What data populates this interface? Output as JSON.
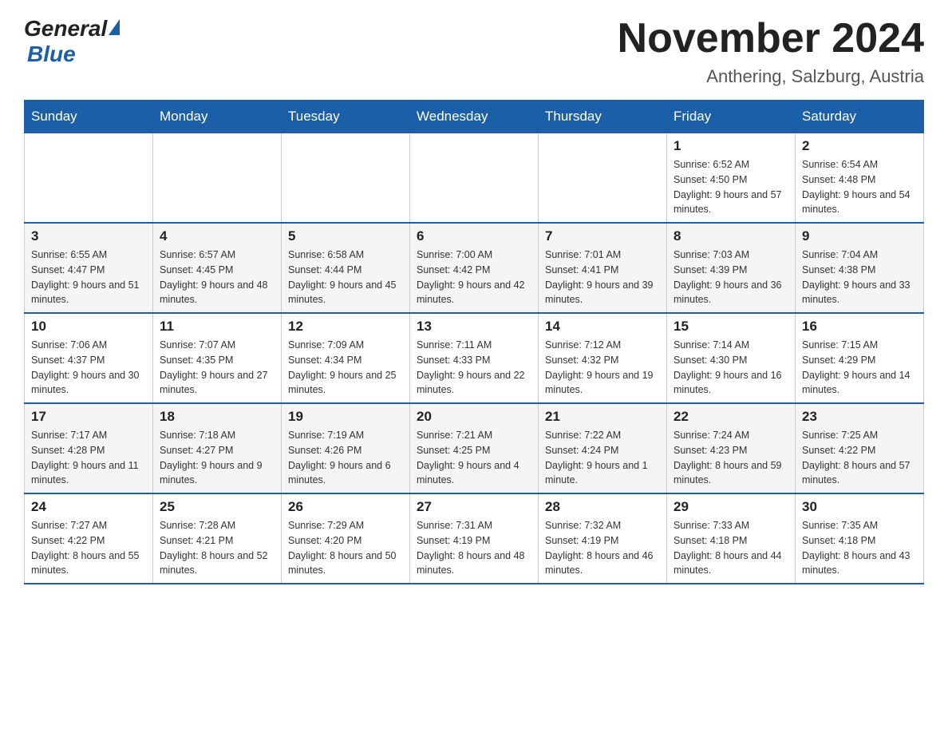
{
  "header": {
    "logo_general": "General",
    "logo_triangle": "▶",
    "logo_blue": "Blue",
    "title": "November 2024",
    "subtitle": "Anthering, Salzburg, Austria"
  },
  "days_of_week": [
    "Sunday",
    "Monday",
    "Tuesday",
    "Wednesday",
    "Thursday",
    "Friday",
    "Saturday"
  ],
  "weeks": [
    {
      "days": [
        {
          "number": "",
          "info": ""
        },
        {
          "number": "",
          "info": ""
        },
        {
          "number": "",
          "info": ""
        },
        {
          "number": "",
          "info": ""
        },
        {
          "number": "",
          "info": ""
        },
        {
          "number": "1",
          "info": "Sunrise: 6:52 AM\nSunset: 4:50 PM\nDaylight: 9 hours and 57 minutes."
        },
        {
          "number": "2",
          "info": "Sunrise: 6:54 AM\nSunset: 4:48 PM\nDaylight: 9 hours and 54 minutes."
        }
      ]
    },
    {
      "days": [
        {
          "number": "3",
          "info": "Sunrise: 6:55 AM\nSunset: 4:47 PM\nDaylight: 9 hours and 51 minutes."
        },
        {
          "number": "4",
          "info": "Sunrise: 6:57 AM\nSunset: 4:45 PM\nDaylight: 9 hours and 48 minutes."
        },
        {
          "number": "5",
          "info": "Sunrise: 6:58 AM\nSunset: 4:44 PM\nDaylight: 9 hours and 45 minutes."
        },
        {
          "number": "6",
          "info": "Sunrise: 7:00 AM\nSunset: 4:42 PM\nDaylight: 9 hours and 42 minutes."
        },
        {
          "number": "7",
          "info": "Sunrise: 7:01 AM\nSunset: 4:41 PM\nDaylight: 9 hours and 39 minutes."
        },
        {
          "number": "8",
          "info": "Sunrise: 7:03 AM\nSunset: 4:39 PM\nDaylight: 9 hours and 36 minutes."
        },
        {
          "number": "9",
          "info": "Sunrise: 7:04 AM\nSunset: 4:38 PM\nDaylight: 9 hours and 33 minutes."
        }
      ]
    },
    {
      "days": [
        {
          "number": "10",
          "info": "Sunrise: 7:06 AM\nSunset: 4:37 PM\nDaylight: 9 hours and 30 minutes."
        },
        {
          "number": "11",
          "info": "Sunrise: 7:07 AM\nSunset: 4:35 PM\nDaylight: 9 hours and 27 minutes."
        },
        {
          "number": "12",
          "info": "Sunrise: 7:09 AM\nSunset: 4:34 PM\nDaylight: 9 hours and 25 minutes."
        },
        {
          "number": "13",
          "info": "Sunrise: 7:11 AM\nSunset: 4:33 PM\nDaylight: 9 hours and 22 minutes."
        },
        {
          "number": "14",
          "info": "Sunrise: 7:12 AM\nSunset: 4:32 PM\nDaylight: 9 hours and 19 minutes."
        },
        {
          "number": "15",
          "info": "Sunrise: 7:14 AM\nSunset: 4:30 PM\nDaylight: 9 hours and 16 minutes."
        },
        {
          "number": "16",
          "info": "Sunrise: 7:15 AM\nSunset: 4:29 PM\nDaylight: 9 hours and 14 minutes."
        }
      ]
    },
    {
      "days": [
        {
          "number": "17",
          "info": "Sunrise: 7:17 AM\nSunset: 4:28 PM\nDaylight: 9 hours and 11 minutes."
        },
        {
          "number": "18",
          "info": "Sunrise: 7:18 AM\nSunset: 4:27 PM\nDaylight: 9 hours and 9 minutes."
        },
        {
          "number": "19",
          "info": "Sunrise: 7:19 AM\nSunset: 4:26 PM\nDaylight: 9 hours and 6 minutes."
        },
        {
          "number": "20",
          "info": "Sunrise: 7:21 AM\nSunset: 4:25 PM\nDaylight: 9 hours and 4 minutes."
        },
        {
          "number": "21",
          "info": "Sunrise: 7:22 AM\nSunset: 4:24 PM\nDaylight: 9 hours and 1 minute."
        },
        {
          "number": "22",
          "info": "Sunrise: 7:24 AM\nSunset: 4:23 PM\nDaylight: 8 hours and 59 minutes."
        },
        {
          "number": "23",
          "info": "Sunrise: 7:25 AM\nSunset: 4:22 PM\nDaylight: 8 hours and 57 minutes."
        }
      ]
    },
    {
      "days": [
        {
          "number": "24",
          "info": "Sunrise: 7:27 AM\nSunset: 4:22 PM\nDaylight: 8 hours and 55 minutes."
        },
        {
          "number": "25",
          "info": "Sunrise: 7:28 AM\nSunset: 4:21 PM\nDaylight: 8 hours and 52 minutes."
        },
        {
          "number": "26",
          "info": "Sunrise: 7:29 AM\nSunset: 4:20 PM\nDaylight: 8 hours and 50 minutes."
        },
        {
          "number": "27",
          "info": "Sunrise: 7:31 AM\nSunset: 4:19 PM\nDaylight: 8 hours and 48 minutes."
        },
        {
          "number": "28",
          "info": "Sunrise: 7:32 AM\nSunset: 4:19 PM\nDaylight: 8 hours and 46 minutes."
        },
        {
          "number": "29",
          "info": "Sunrise: 7:33 AM\nSunset: 4:18 PM\nDaylight: 8 hours and 44 minutes."
        },
        {
          "number": "30",
          "info": "Sunrise: 7:35 AM\nSunset: 4:18 PM\nDaylight: 8 hours and 43 minutes."
        }
      ]
    }
  ]
}
